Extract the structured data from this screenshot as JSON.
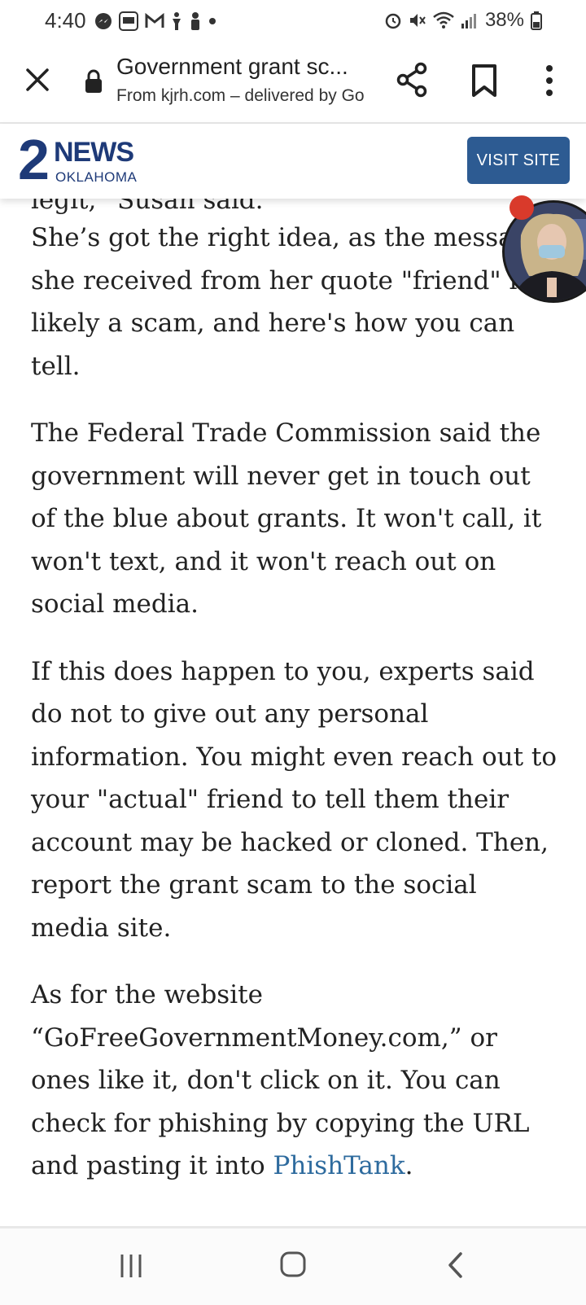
{
  "status_bar": {
    "time": "4:40",
    "left_icons": [
      "messenger-icon",
      "slots-app-icon",
      "gmail-icon",
      "figure-icon",
      "person-icon",
      "dot-icon"
    ],
    "right_icons": [
      "alarm-icon",
      "mute-icon",
      "wifi-icon",
      "signal-icon"
    ],
    "battery": "38%"
  },
  "toolbar": {
    "title": "Government grant sc...",
    "subtitle": "From kjrh.com – delivered by Go"
  },
  "site_header": {
    "logo_two": "2",
    "logo_news": "NEWS",
    "logo_region": "OKLAHOMA",
    "visit_button": "VISIT SITE"
  },
  "article": {
    "cut_line": "legit,” Susan said.",
    "paragraphs": [
      "She’s got the right idea, as the message she received from her quote \"friend\" is likely a scam, and here's how you can tell.",
      "The Federal Trade Commission said the government will never get in touch out of the blue about grants. It won't call, it won't text, and it won't reach out on social media.",
      "If this does happen to you, experts said do not to give out any personal information. You might even reach out to your \"actual\" friend to tell them their account may be hacked or cloned. Then, report the grant scam to the social media site."
    ],
    "last_paragraph_text": "As for the website “GoFreeGovernmentMoney.com,” or ones like it, don't click on it. You can check for phishing by copying the URL and pasting it into ",
    "link_text": "PhishTank",
    "last_paragraph_end": "."
  },
  "colors": {
    "brand_blue": "#1e3a78",
    "visit_button": "#2d5b92",
    "link": "#2e6b9e",
    "notification": "#d93a2b"
  }
}
